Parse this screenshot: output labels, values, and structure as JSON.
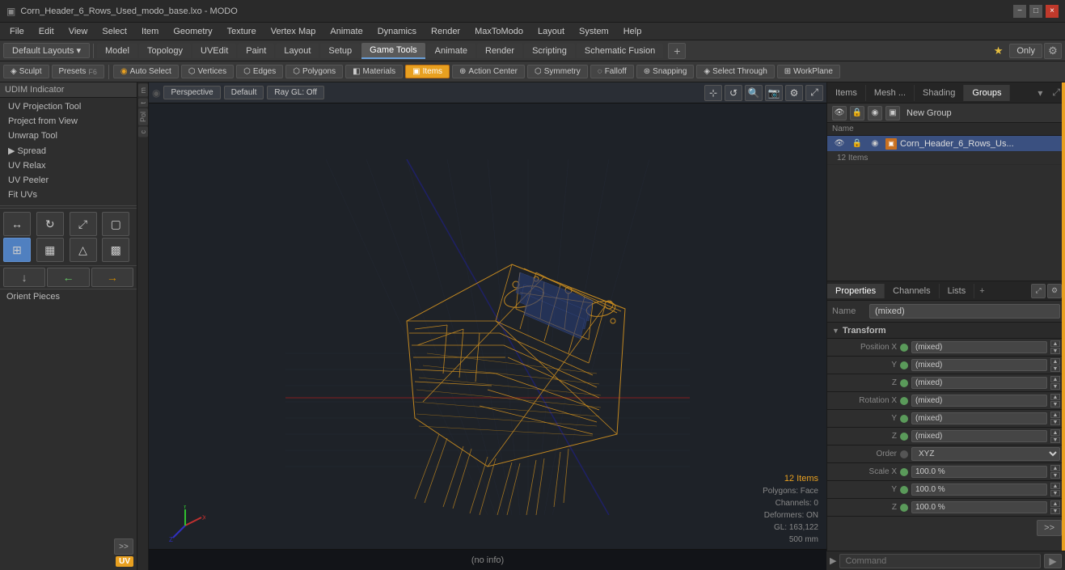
{
  "titlebar": {
    "title": "Corn_Header_6_Rows_Used_modo_base.lxo - MODO",
    "minimize": "−",
    "maximize": "□",
    "close": "×"
  },
  "menubar": {
    "items": [
      "File",
      "Edit",
      "View",
      "Select",
      "Item",
      "Geometry",
      "Texture",
      "Vertex Map",
      "Animate",
      "Dynamics",
      "Render",
      "MaxToModo",
      "Layout",
      "System",
      "Help"
    ]
  },
  "toolbar": {
    "layout_label": "Default Layouts ▾",
    "tabs": [
      "Model",
      "Topology",
      "UVEdit",
      "Paint",
      "Layout",
      "Setup",
      "Game Tools",
      "Animate",
      "Render",
      "Scripting",
      "Schematic Fusion"
    ],
    "active_tab": "Game Tools",
    "plus_label": "+",
    "star_label": "★",
    "only_label": "Only",
    "gear_label": "⚙"
  },
  "tool_toolbar": {
    "sculpt_label": "Sculpt",
    "presets_label": "Presets",
    "f6_label": "F6",
    "auto_select": "Auto Select",
    "vertices": "Vertices",
    "edges": "Edges",
    "polygons": "Polygons",
    "materials": "Materials",
    "items": "Items",
    "action_center": "Action Center",
    "symmetry": "Symmetry",
    "falloff": "Falloff",
    "snapping": "Snapping",
    "select_through": "Select Through",
    "workplane": "WorkPlane"
  },
  "left_panel": {
    "header": "UDIM Indicator",
    "items": [
      "UV Projection Tool",
      "Project from View",
      "Unwrap Tool",
      "▶ Spread",
      "UV Relax",
      "UV Peeler",
      "Fit UVs"
    ]
  },
  "viewport": {
    "perspective_label": "Perspective",
    "default_label": "Default",
    "ray_gl_label": "Ray GL: Off",
    "status_info": "(no info)"
  },
  "info_overlay": {
    "items_count": "12 Items",
    "polygons": "Polygons: Face",
    "channels": "Channels: 0",
    "deformers": "Deformers: ON",
    "gl_info": "GL: 163,122",
    "size": "500 mm"
  },
  "right_panel": {
    "tabs": [
      "Items",
      "Mesh ...",
      "Shading",
      "Groups"
    ],
    "active_tab": "Groups",
    "new_group_label": "New Group",
    "name_column": "Name",
    "item_name": "Corn_Header_6_Rows_Us...",
    "item_count": "12 Items"
  },
  "properties": {
    "tabs": [
      "Properties",
      "Channels",
      "Lists"
    ],
    "active_tab": "Properties",
    "plus_label": "+",
    "name_label": "Name",
    "name_value": "(mixed)",
    "transform_section": "Transform",
    "fields": [
      {
        "label": "Position X",
        "value": "(mixed)"
      },
      {
        "label": "Y",
        "value": "(mixed)"
      },
      {
        "label": "Z",
        "value": "(mixed)"
      },
      {
        "label": "Rotation X",
        "value": "(mixed)"
      },
      {
        "label": "Y",
        "value": "(mixed)"
      },
      {
        "label": "Z",
        "value": "(mixed)"
      },
      {
        "label": "Order",
        "value": "XYZ",
        "type": "select"
      },
      {
        "label": "Scale X",
        "value": "100.0 %"
      },
      {
        "label": "Y",
        "value": "100.0 %"
      },
      {
        "label": "Z",
        "value": "100.0 %"
      }
    ]
  },
  "command_bar": {
    "placeholder": "Command",
    "run_icon": "▶"
  },
  "colors": {
    "accent_orange": "#e8a020",
    "active_blue": "#3a5080",
    "viewport_bg": "#1e2228"
  }
}
